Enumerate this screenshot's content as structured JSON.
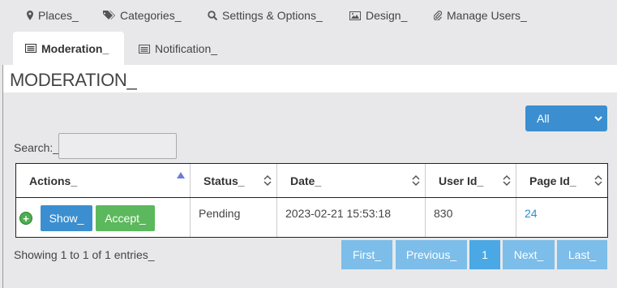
{
  "tabs": [
    {
      "label": "Places_",
      "icon": "map-marker-icon"
    },
    {
      "label": "Categories_",
      "icon": "tags-icon"
    },
    {
      "label": "Settings & Options_",
      "icon": "search-icon"
    },
    {
      "label": "Design_",
      "icon": "image-icon"
    },
    {
      "label": "Manage Users_",
      "icon": "paperclip-icon"
    }
  ],
  "active_tab": {
    "label": "Moderation_",
    "icon": "list-icon"
  },
  "notification_tab": {
    "label": "Notification_",
    "icon": "list-icon"
  },
  "page_title": "MODERATION_",
  "filter": {
    "selected": "All"
  },
  "search": {
    "label": "Search:_",
    "value": ""
  },
  "table": {
    "columns": [
      "Actions_",
      "Status_",
      "Date_",
      "User Id_",
      "Page Id_"
    ],
    "rows": [
      {
        "actions": {
          "show": "Show_",
          "accept": "Accept_"
        },
        "status": "Pending",
        "date": "2023-02-21 15:53:18",
        "user_id": "830",
        "page_id": "24"
      }
    ]
  },
  "info": "Showing 1 to 1 of 1 entries_",
  "pagination": {
    "first": "First_",
    "previous": "Previous_",
    "current": "1",
    "next": "Next_",
    "last": "Last_"
  },
  "colors": {
    "primary": "#3b8fd0",
    "success": "#5cb85c",
    "pager": "#7cbde9",
    "link": "#2a8ed0"
  }
}
